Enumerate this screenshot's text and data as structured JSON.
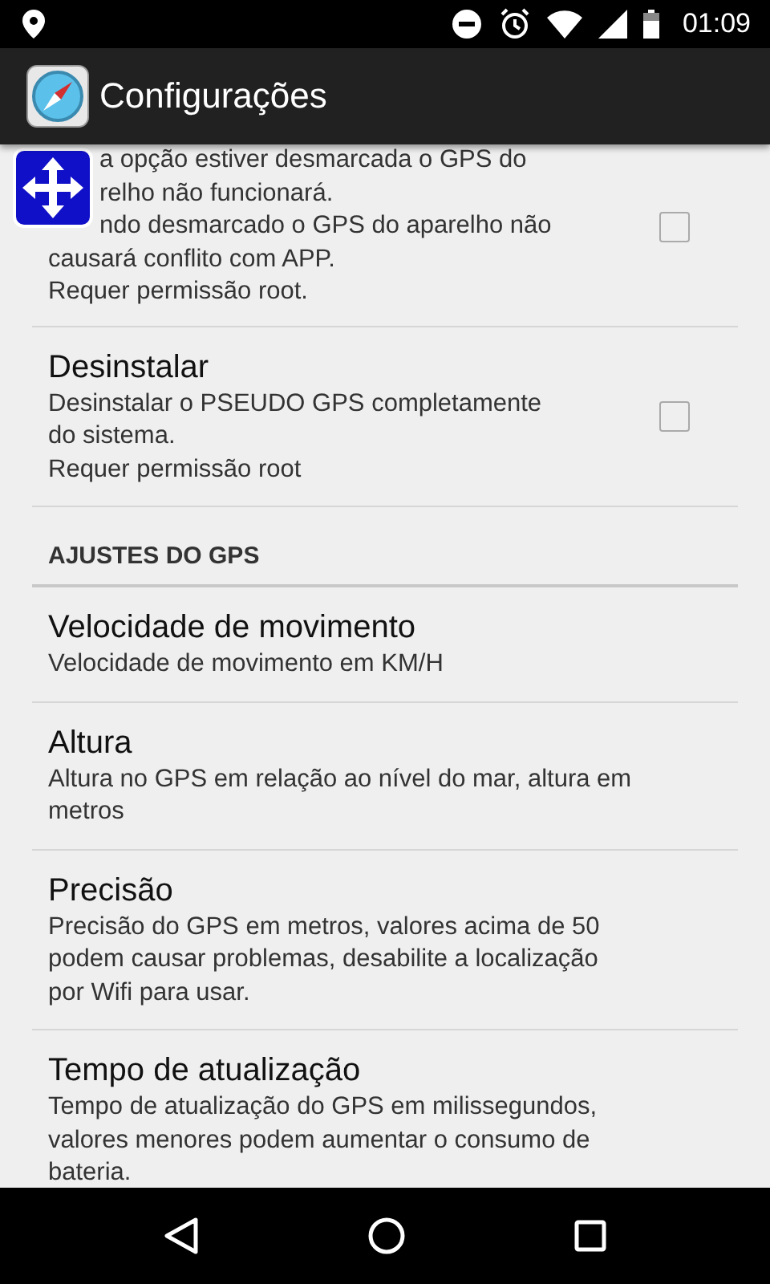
{
  "status_bar": {
    "time": "01:09"
  },
  "action_bar": {
    "title": "Configurações"
  },
  "settings": [
    {
      "kind": "checkbox",
      "checked": false,
      "covered_lines": [
        "a opção estiver desmarcada o GPS do",
        "relho não funcionará.",
        "ndo desmarcado o GPS do aparelho não"
      ],
      "summary": "causará conflito com APP.\nRequer permissão root."
    },
    {
      "kind": "checkbox",
      "checked": false,
      "title": "Desinstalar",
      "summary": "Desinstalar o PSEUDO GPS completamente\ndo sistema.\nRequer permissão root"
    },
    {
      "kind": "category",
      "title": "AJUSTES DO GPS"
    },
    {
      "kind": "plain",
      "title": "Velocidade de movimento",
      "summary": "Velocidade de movimento em KM/H"
    },
    {
      "kind": "plain",
      "title": "Altura",
      "summary": "Altura no GPS em relação ao nível do mar, altura em\nmetros"
    },
    {
      "kind": "plain",
      "title": "Precisão",
      "summary": "Precisão do GPS em metros, valores acima de 50\npodem causar problemas, desabilite a localização\npor Wifi para usar."
    },
    {
      "kind": "plain",
      "title": "Tempo de atualização",
      "summary": "Tempo de atualização do GPS em milissegundos,\nvalores menores podem aumentar o consumo de\nbateria."
    }
  ]
}
